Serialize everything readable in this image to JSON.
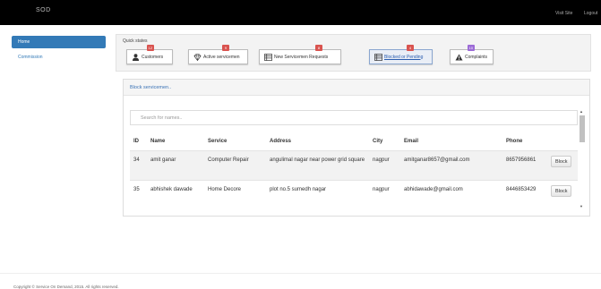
{
  "header": {
    "brand": "SOD",
    "visit_site": "Visit Site",
    "logout": "Logout"
  },
  "sidebar": {
    "items": [
      {
        "label": "Home",
        "active": true
      },
      {
        "label": "Commission",
        "active": false
      }
    ]
  },
  "quick_states": {
    "title": "Quick states",
    "buttons": [
      {
        "label": "Customers",
        "count": "12",
        "icon": "user-icon",
        "badge_color": "#d9534f"
      },
      {
        "label": "Active servicemen",
        "count": "9",
        "icon": "diamond-icon",
        "badge_color": "#d9534f"
      },
      {
        "label": "New Servicemen Requests",
        "count": "8",
        "icon": "list-icon",
        "badge_color": "#d9534f"
      },
      {
        "label": "Blocked or Pending",
        "count": "4",
        "icon": "list-icon",
        "badge_color": "#d9534f"
      },
      {
        "label": "Complaints",
        "count": "10",
        "icon": "warning-icon",
        "badge_color": "#9b6ad6"
      }
    ]
  },
  "panel": {
    "title": "Block servicemen..",
    "search_placeholder": "Search for names.."
  },
  "table": {
    "columns": [
      "ID",
      "Name",
      "Service",
      "Address",
      "City",
      "Email",
      "Phone"
    ],
    "rows": [
      {
        "id": "34",
        "name": "amit ganar",
        "service": "Computer Repair",
        "address": "angulimal nagar near power grid square",
        "city": "nagpur",
        "email": "amitganar8657@gmail.com",
        "phone": "8657956861",
        "action": "Block"
      },
      {
        "id": "35",
        "name": "abhishek dawade",
        "service": "Home Decore",
        "address": "plot no.5 sumedh nagar",
        "city": "nagpur",
        "email": "abhidawade@gmail.com",
        "phone": "8446853429",
        "action": "Block"
      }
    ]
  },
  "footer": {
    "text": "Copyright © Service On Demand, 2015. All rights reserved."
  },
  "colors": {
    "topbar": "#000000",
    "accent": "#337ab7",
    "badge_red": "#d9534f",
    "badge_purple": "#9b6ad6"
  }
}
